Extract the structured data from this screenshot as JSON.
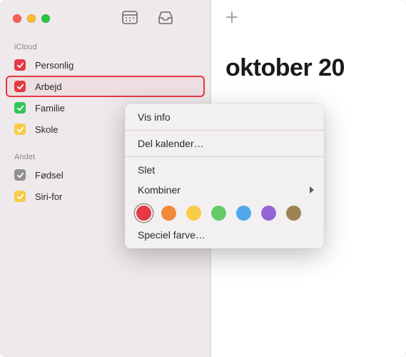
{
  "header": {
    "month_title": "oktober 20"
  },
  "sidebar": {
    "sections": [
      {
        "title": "iCloud",
        "items": [
          {
            "label": "Personlig",
            "color": "#E53945",
            "checked": true,
            "selected": false
          },
          {
            "label": "Arbejd",
            "color": "#E53945",
            "checked": true,
            "selected": true
          },
          {
            "label": "Familie",
            "color": "#31C55A",
            "checked": true,
            "selected": false
          },
          {
            "label": "Skole",
            "color": "#F8CC46",
            "checked": true,
            "selected": false
          }
        ]
      },
      {
        "title": "Andet",
        "items": [
          {
            "label": "Fødsel",
            "color": "#8E8E93",
            "checked": true,
            "selected": false
          },
          {
            "label": "Siri-for",
            "color": "#F8CC46",
            "checked": true,
            "selected": false
          }
        ]
      }
    ]
  },
  "context_menu": {
    "items": [
      {
        "type": "item",
        "label": "Vis info"
      },
      {
        "type": "sep"
      },
      {
        "type": "item",
        "label": "Del kalender…"
      },
      {
        "type": "sep"
      },
      {
        "type": "item",
        "label": "Slet"
      },
      {
        "type": "item",
        "label": "Kombiner",
        "submenu": true
      },
      {
        "type": "colors",
        "swatches": [
          {
            "color": "#E53945",
            "selected": true
          },
          {
            "color": "#F0893A",
            "selected": false
          },
          {
            "color": "#F8CC46",
            "selected": false
          },
          {
            "color": "#63CB67",
            "selected": false
          },
          {
            "color": "#4FA9E8",
            "selected": false
          },
          {
            "color": "#9365D6",
            "selected": false
          },
          {
            "color": "#9C8354",
            "selected": false
          }
        ]
      },
      {
        "type": "item",
        "label": "Speciel farve…"
      }
    ]
  },
  "icons": {
    "calendar_toggle": "calendar-icon",
    "inbox": "inbox-icon",
    "add_event": "plus-icon"
  }
}
